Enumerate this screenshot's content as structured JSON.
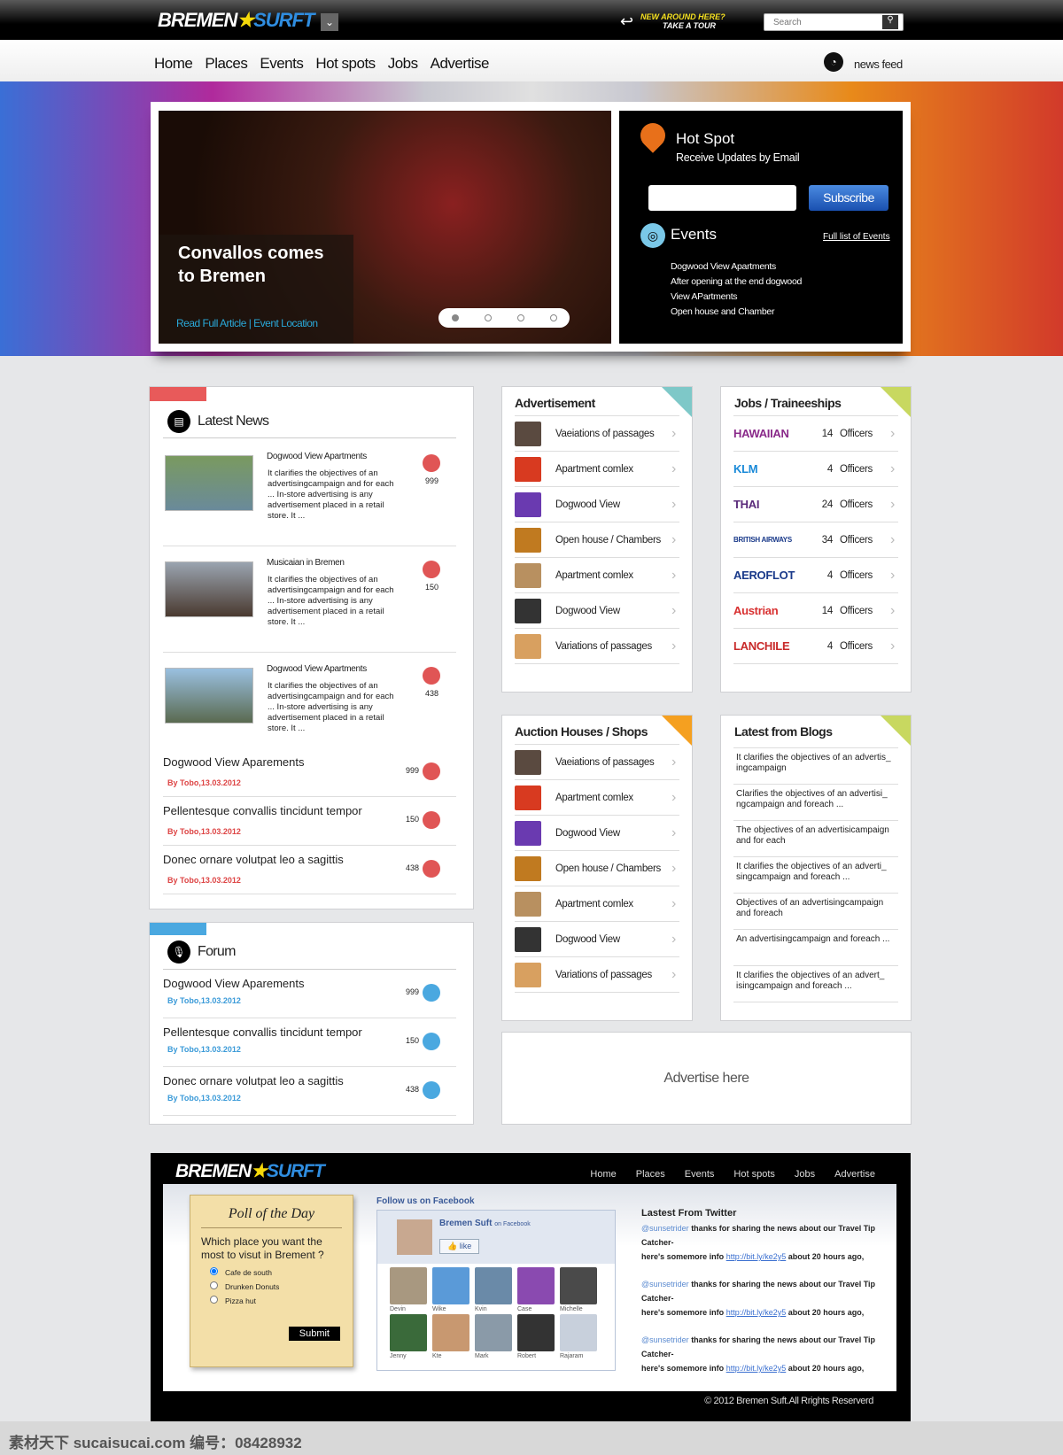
{
  "header": {
    "logo": {
      "part1": "BREMEN",
      "star": "★",
      "part2": "SURFT"
    },
    "tour_line1": "NEW AROUND HERE?",
    "tour_line2": "TAKE A TOUR",
    "search_placeholder": "Search"
  },
  "nav": {
    "items": [
      "Home",
      "Places",
      "Events",
      "Hot spots",
      "Jobs",
      "Advertise"
    ],
    "news_feed": "news feed"
  },
  "hero": {
    "title_line1": "Convallos comes",
    "title_line2": "to Bremen",
    "links": "Read Full Article | Event Location",
    "slides": 4,
    "active_slide": 1
  },
  "hotspot": {
    "title": "Hot  Spot",
    "subtitle": "Receive Updates by Email",
    "email_value": "",
    "subscribe": "Subscribe",
    "events_title": "Events",
    "full_list": "Full list of Events",
    "events": [
      "Dogwood View Apartments",
      "After opening at the end dogwood",
      "View APartments",
      "Open house and Chamber"
    ]
  },
  "latest_news": {
    "title": "Latest News",
    "accent": "#e85a5a",
    "featured": [
      {
        "title": "Dogwood View Apartments",
        "body": "It clarifies the objectives of an advertisingcampaign and for each ... In-store advertising is any advertisement placed in a retail store. It ...",
        "count": "999"
      },
      {
        "title": "Musicaian in Bremen",
        "body": "It clarifies the objectives of an advertisingcampaign and for each ... In-store advertising is any advertisement placed in a retail store. It ...",
        "count": "150"
      },
      {
        "title": "Dogwood View Apartments",
        "body": "It clarifies the objectives of an advertisingcampaign and for each ... In-store advertising is any advertisement placed in a retail store. It ...",
        "count": "438"
      }
    ],
    "list": [
      {
        "title": "Dogwood View Aparements",
        "by": "By Tobo,13.03.2012",
        "count": "999"
      },
      {
        "title": "Pellentesque convallis tincidunt tempor",
        "by": "By Tobo,13.03.2012",
        "count": "150"
      },
      {
        "title": "Donec ornare volutpat leo a sagittis",
        "by": "By Tobo,13.03.2012",
        "count": "438"
      }
    ]
  },
  "forum": {
    "title": "Forum",
    "accent": "#4aa8e0",
    "list": [
      {
        "title": "Dogwood View Aparements",
        "by": "By Tobo,13.03.2012",
        "count": "999"
      },
      {
        "title": "Pellentesque convallis tincidunt tempor",
        "by": "By Tobo,13.03.2012",
        "count": "150"
      },
      {
        "title": "Donec ornare volutpat leo a sagittis",
        "by": "By Tobo,13.03.2012",
        "count": "438"
      }
    ]
  },
  "advertisement": {
    "title": "Advertisement",
    "accent": "#7ec8c8",
    "items": [
      "Vaeiations of passages",
      "Apartment comlex",
      "Dogwood View",
      "Open house / Chambers",
      "Apartment comlex",
      "Dogwood View",
      "Variations of passages"
    ]
  },
  "auction": {
    "title": "Auction Houses / Shops",
    "accent": "#f5a020",
    "items": [
      "Vaeiations of passages",
      "Apartment comlex",
      "Dogwood View",
      "Open house / Chambers",
      "Apartment comlex",
      "Dogwood View",
      "Variations of passages"
    ]
  },
  "jobs": {
    "title": "Jobs / Traineeships",
    "accent": "#c8d860",
    "items": [
      {
        "company": "HAWAIIAN",
        "count": "14",
        "label": "Officers"
      },
      {
        "company": "KLM",
        "count": "4",
        "label": "Officers"
      },
      {
        "company": "THAI",
        "count": "24",
        "label": "Officers"
      },
      {
        "company": "BRITISH AIRWAYS",
        "count": "34",
        "label": "Officers"
      },
      {
        "company": "AEROFLOT",
        "count": "4",
        "label": "Officers"
      },
      {
        "company": "Austrian",
        "count": "14",
        "label": "Officers"
      },
      {
        "company": "LANCHILE",
        "count": "4",
        "label": "Officers"
      }
    ]
  },
  "blogs": {
    "title": "Latest from Blogs",
    "accent": "#c8d860",
    "items": [
      "It clarifies the objectives of an advertis_ ingcampaign",
      "Clarifies the objectives of an advertisi_ ngcampaign and foreach ...",
      "The objectives of an advertisicampaign and for each",
      "It clarifies the objectives of an adverti_ singcampaign and foreach ...",
      "Objectives of an advertisingcampaign and foreach",
      "An advertisingcampaign and foreach ...",
      "It clarifies the objectives of an advert_ isingcampaign and foreach ..."
    ]
  },
  "advertise_here": "Advertise here",
  "footer": {
    "nav": [
      "Home",
      "Places",
      "Events",
      "Hot spots",
      "Jobs",
      "Advertise"
    ],
    "poll": {
      "title": "Poll of the Day",
      "question": "Which place you want the most to visut in Brement ?",
      "options": [
        "Cafe de south",
        "Drunken Donuts",
        "Pizza hut"
      ],
      "selected": 0,
      "submit": "Submit"
    },
    "facebook": {
      "heading": "Follow us on Facebook",
      "page": "Bremen Suft",
      "on": "on Facebook",
      "like": "like",
      "fans": [
        "Devin",
        "Wike",
        "Kvin",
        "Case",
        "Michelle",
        "Jenny",
        "Kte",
        "Mark",
        "Robert",
        "Rajaram"
      ]
    },
    "twitter": {
      "heading": "Lastest From Twitter",
      "tweets": [
        {
          "user": "@sunsetrider",
          "text1": "thanks for sharing the news about our Travel Tip Catcher-",
          "text2": "here's somemore info",
          "link": "http://bit.ly/ke2y5",
          "time": "about 20 hours ago,"
        },
        {
          "user": "@sunsetrider",
          "text1": "thanks for sharing the news about our Travel Tip Catcher-",
          "text2": "here's somemore info",
          "link": "http://bit.ly/ke2y5",
          "time": "about 20 hours ago,"
        },
        {
          "user": "@sunsetrider",
          "text1": "thanks for sharing the news about our Travel Tip Catcher-",
          "text2": "here's somemore info",
          "link": "http://bit.ly/ke2y5",
          "time": "about 20 hours ago,"
        }
      ]
    },
    "copyright": "© 2012 Bremen Suft.All  Rrights Reserverd"
  },
  "watermark": "素材天下 sucaisucai.com  编号：08428932"
}
